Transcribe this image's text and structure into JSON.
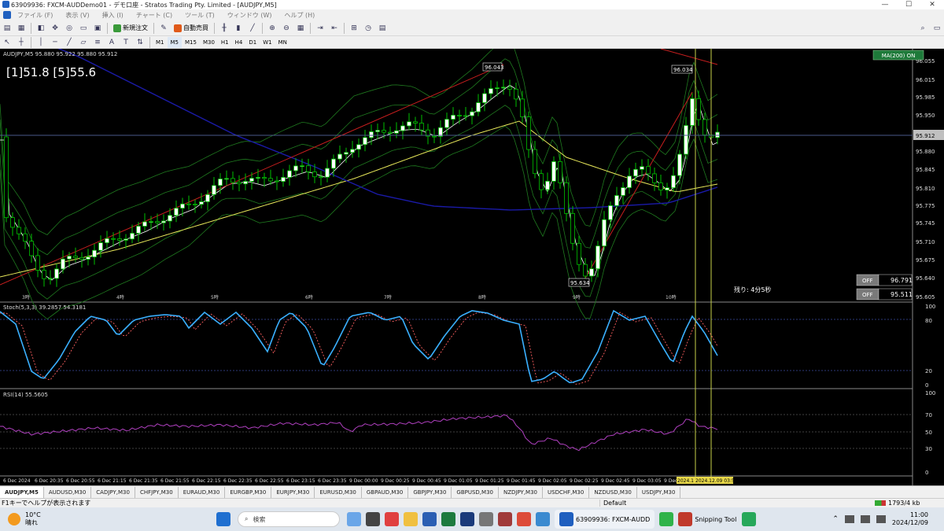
{
  "window": {
    "title": "63909936: FXCM-AUDDemo01 - デモ口座 - Stratos Trading Pty. Limited - [AUDJPY,M5]",
    "controls": [
      "—",
      "☐",
      "✕"
    ]
  },
  "menu": [
    "ファイル (F)",
    "表示 (V)",
    "挿入 (I)",
    "チャート (C)",
    "ツール (T)",
    "ウィンドウ (W)",
    "ヘルプ (H)"
  ],
  "toolbar": {
    "new_order": "新規注文",
    "auto_trade": "自動売買"
  },
  "timeframes": [
    "M1",
    "M5",
    "M15",
    "M30",
    "H1",
    "H4",
    "D1",
    "W1",
    "MN"
  ],
  "chart": {
    "symbol_label": "AUDJPY,M5  95.880 95.922 95.880 95.912",
    "overlay_text": "[1]51.8 [5]55.6",
    "ma_button": "MA(200) ON",
    "remaining": "残り: 4分5秒",
    "off_btn_1": "OFF",
    "off_val_1": "96.791",
    "off_btn_2": "OFF",
    "off_val_2": "95.511",
    "high_label": "96.043",
    "high_label_2": "96.034",
    "low_label": "95.634",
    "current_price": "95.912",
    "price_ticks": [
      "96.055",
      "96.015",
      "95.985",
      "95.950",
      "95.912",
      "95.880",
      "95.845",
      "95.810",
      "95.775",
      "95.745",
      "95.710",
      "95.675",
      "95.640",
      "95.605"
    ],
    "hour_marks": [
      "3時",
      "4時",
      "5時",
      "6時",
      "7時",
      "8時",
      "9時",
      "10時"
    ],
    "stoch_label": "Stoch(5,3,3) 39.2857 54.3181",
    "stoch_ticks": [
      "100",
      "80",
      "20",
      "0"
    ],
    "rsi_label": "RSI(14) 55.5605",
    "rsi_ticks": [
      "100",
      "70",
      "50",
      "30",
      "0"
    ],
    "time_labels": [
      "6 Dec 2024",
      "6 Dec 20:35",
      "6 Dec 20:55",
      "6 Dec 21:15",
      "6 Dec 21:35",
      "6 Dec 21:55",
      "6 Dec 22:15",
      "6 Dec 22:35",
      "6 Dec 22:55",
      "6 Dec 23:15",
      "6 Dec 23:35",
      "9 Dec 00:00",
      "9 Dec 00:25",
      "9 Dec 00:45",
      "9 Dec 01:05",
      "9 Dec 01:25",
      "9 Dec 01:45",
      "9 Dec 02:05",
      "9 Dec 02:25",
      "9 Dec 02:45",
      "9 Dec 03:05",
      "9 Dec"
    ],
    "time_highlight_1": "2024.1",
    "time_highlight_2": "2024.12.09 03:55"
  },
  "tabs": [
    "AUDJPY,M5",
    "AUDUSD,M30",
    "CADJPY,M30",
    "CHFJPY,M30",
    "EURAUD,M30",
    "EURGBP,M30",
    "EURJPY,M30",
    "EURUSD,M30",
    "GBPAUD,M30",
    "GBPJPY,M30",
    "GBPUSD,M30",
    "NZDJPY,M30",
    "USDCHF,M30",
    "NZDUSD,M30",
    "USDJPY,M30"
  ],
  "status": {
    "help": "F1キーでヘルプが表示されます",
    "profile": "Default",
    "traffic": "1793/4 kb"
  },
  "taskbar": {
    "weather_temp": "10°C",
    "weather_desc": "晴れ",
    "search": "検索",
    "app_label": "63909936: FXCM-AUDD",
    "tool_label": "Snipping Tool",
    "time": "11:00",
    "date": "2024/12/09"
  },
  "colors": {
    "bull_candle": "#ffffff",
    "bear_candle": "#000000",
    "candle_outline": "#00c000",
    "bollinger": "#1f7a1f",
    "ma_fast": "#ffffff",
    "ma_mid": "#e8e85a",
    "ma_slow": "#1a1aa8",
    "trendline": "#c81e1e",
    "stoch_main": "#3ab0ff",
    "stoch_signal": "#ff6060",
    "rsi_line": "#b040c0"
  }
}
